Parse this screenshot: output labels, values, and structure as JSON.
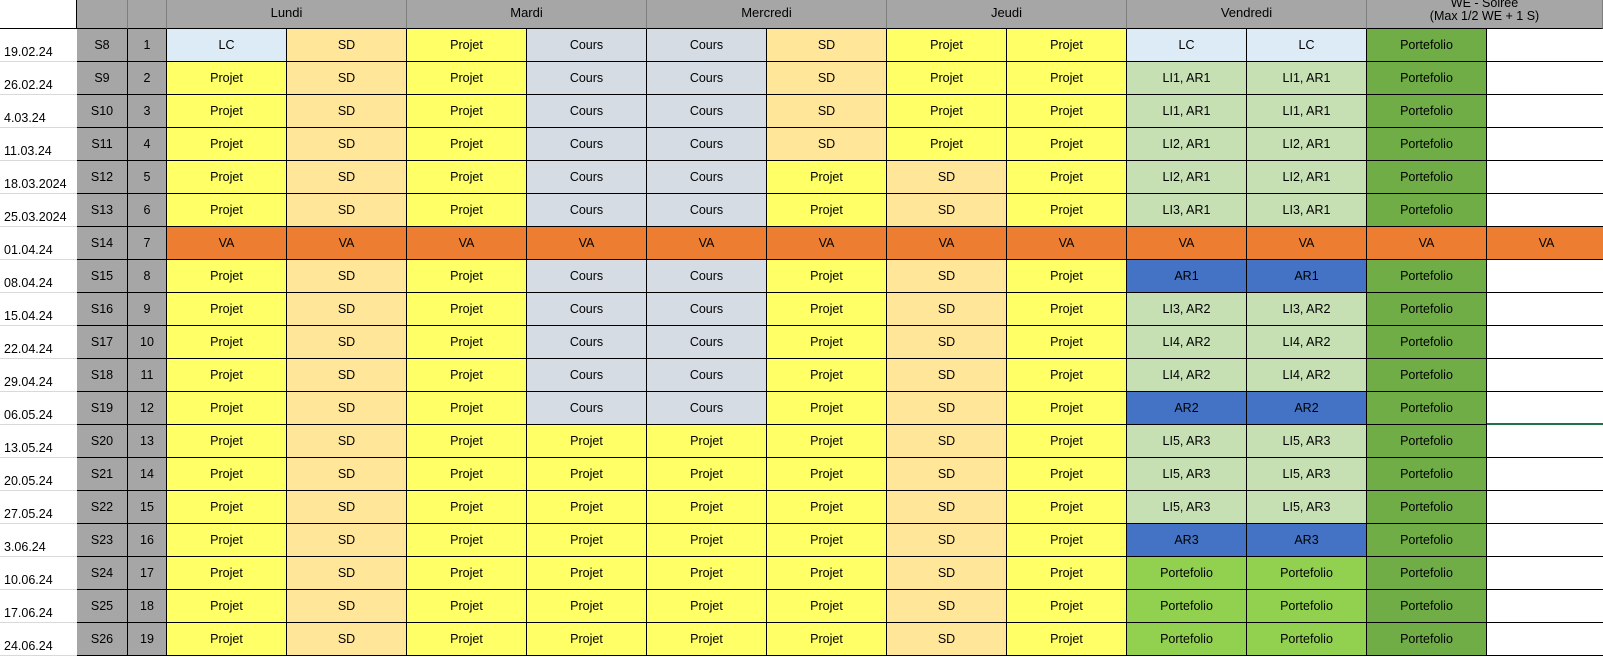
{
  "headers": {
    "days": [
      "Lundi",
      "Mardi",
      "Mercredi",
      "Jeudi",
      "Vendredi"
    ],
    "we_line1": "WE - Soirée",
    "we_line2": "(Max 1/2 WE + 1 S)"
  },
  "colors": {
    "Projet": "#ffff66",
    "SD": "#ffe699",
    "Cours": "#d6dce4",
    "LC": "#ddebf7",
    "VA": "#ed7d31",
    "Portefolio_we": "#70ad47",
    "Portefolio_ven": "#92d050",
    "LI": "#c6e0b4",
    "AR": "#4472c4",
    "header": "#a6a6a6"
  },
  "rows": [
    {
      "date": "19.02.24",
      "week": "S8",
      "num": "1",
      "cells": [
        "LC",
        "SD",
        "Projet",
        "Cours",
        "Cours",
        "SD",
        "Projet",
        "Projet",
        "LC",
        "LC",
        "Portefolio",
        ""
      ]
    },
    {
      "date": "26.02.24",
      "week": "S9",
      "num": "2",
      "cells": [
        "Projet",
        "SD",
        "Projet",
        "Cours",
        "Cours",
        "SD",
        "Projet",
        "Projet",
        "LI1, AR1",
        "LI1, AR1",
        "Portefolio",
        ""
      ]
    },
    {
      "date": "4.03.24",
      "week": "S10",
      "num": "3",
      "cells": [
        "Projet",
        "SD",
        "Projet",
        "Cours",
        "Cours",
        "SD",
        "Projet",
        "Projet",
        "LI1, AR1",
        "LI1, AR1",
        "Portefolio",
        ""
      ]
    },
    {
      "date": "11.03.24",
      "week": "S11",
      "num": "4",
      "cells": [
        "Projet",
        "SD",
        "Projet",
        "Cours",
        "Cours",
        "SD",
        "Projet",
        "Projet",
        "LI2, AR1",
        "LI2, AR1",
        "Portefolio",
        ""
      ]
    },
    {
      "date": "18.03.2024",
      "week": "S12",
      "num": "5",
      "cells": [
        "Projet",
        "SD",
        "Projet",
        "Cours",
        "Cours",
        "Projet",
        "SD",
        "Projet",
        "LI2, AR1",
        "LI2, AR1",
        "Portefolio",
        ""
      ]
    },
    {
      "date": "25.03.2024",
      "week": "S13",
      "num": "6",
      "cells": [
        "Projet",
        "SD",
        "Projet",
        "Cours",
        "Cours",
        "Projet",
        "SD",
        "Projet",
        "LI3, AR1",
        "LI3, AR1",
        "Portefolio",
        ""
      ]
    },
    {
      "date": "01.04.24",
      "week": "S14",
      "num": "7",
      "cells": [
        "VA",
        "VA",
        "VA",
        "VA",
        "VA",
        "VA",
        "VA",
        "VA",
        "VA",
        "VA",
        "VA",
        "VA"
      ]
    },
    {
      "date": "08.04.24",
      "week": "S15",
      "num": "8",
      "cells": [
        "Projet",
        "SD",
        "Projet",
        "Cours",
        "Cours",
        "Projet",
        "SD",
        "Projet",
        "AR1",
        "AR1",
        "Portefolio",
        ""
      ]
    },
    {
      "date": "15.04.24",
      "week": "S16",
      "num": "9",
      "cells": [
        "Projet",
        "SD",
        "Projet",
        "Cours",
        "Cours",
        "Projet",
        "SD",
        "Projet",
        "LI3, AR2",
        "LI3, AR2",
        "Portefolio",
        ""
      ]
    },
    {
      "date": "22.04.24",
      "week": "S17",
      "num": "10",
      "cells": [
        "Projet",
        "SD",
        "Projet",
        "Cours",
        "Cours",
        "Projet",
        "SD",
        "Projet",
        "LI4, AR2",
        "LI4, AR2",
        "Portefolio",
        ""
      ]
    },
    {
      "date": "29.04.24",
      "week": "S18",
      "num": "11",
      "cells": [
        "Projet",
        "SD",
        "Projet",
        "Cours",
        "Cours",
        "Projet",
        "SD",
        "Projet",
        "LI4, AR2",
        "LI4, AR2",
        "Portefolio",
        ""
      ]
    },
    {
      "date": "06.05.24",
      "week": "S19",
      "num": "12",
      "cells": [
        "Projet",
        "SD",
        "Projet",
        "Cours",
        "Cours",
        "Projet",
        "SD",
        "Projet",
        "AR2",
        "AR2",
        "Portefolio",
        ""
      ]
    },
    {
      "date": "13.05.24",
      "week": "S20",
      "num": "13",
      "cells": [
        "Projet",
        "SD",
        "Projet",
        "Projet",
        "Projet",
        "Projet",
        "SD",
        "Projet",
        "LI5, AR3",
        "LI5, AR3",
        "Portefolio",
        ""
      ]
    },
    {
      "date": "20.05.24",
      "week": "S21",
      "num": "14",
      "cells": [
        "Projet",
        "SD",
        "Projet",
        "Projet",
        "Projet",
        "Projet",
        "SD",
        "Projet",
        "LI5, AR3",
        "LI5, AR3",
        "Portefolio",
        ""
      ]
    },
    {
      "date": "27.05.24",
      "week": "S22",
      "num": "15",
      "cells": [
        "Projet",
        "SD",
        "Projet",
        "Projet",
        "Projet",
        "Projet",
        "SD",
        "Projet",
        "LI5, AR3",
        "LI5, AR3",
        "Portefolio",
        ""
      ]
    },
    {
      "date": "3.06.24",
      "week": "S23",
      "num": "16",
      "cells": [
        "Projet",
        "SD",
        "Projet",
        "Projet",
        "Projet",
        "Projet",
        "SD",
        "Projet",
        "AR3",
        "AR3",
        "Portefolio",
        ""
      ]
    },
    {
      "date": "10.06.24",
      "week": "S24",
      "num": "17",
      "cells": [
        "Projet",
        "SD",
        "Projet",
        "Projet",
        "Projet",
        "Projet",
        "SD",
        "Projet",
        "Portefolio",
        "Portefolio",
        "Portefolio",
        ""
      ]
    },
    {
      "date": "17.06.24",
      "week": "S25",
      "num": "18",
      "cells": [
        "Projet",
        "SD",
        "Projet",
        "Projet",
        "Projet",
        "Projet",
        "SD",
        "Projet",
        "Portefolio",
        "Portefolio",
        "Portefolio",
        ""
      ]
    },
    {
      "date": "24.06.24",
      "week": "S26",
      "num": "19",
      "cells": [
        "Projet",
        "SD",
        "Projet",
        "Projet",
        "Projet",
        "Projet",
        "SD",
        "Projet",
        "Portefolio",
        "Portefolio",
        "Portefolio",
        ""
      ]
    }
  ]
}
